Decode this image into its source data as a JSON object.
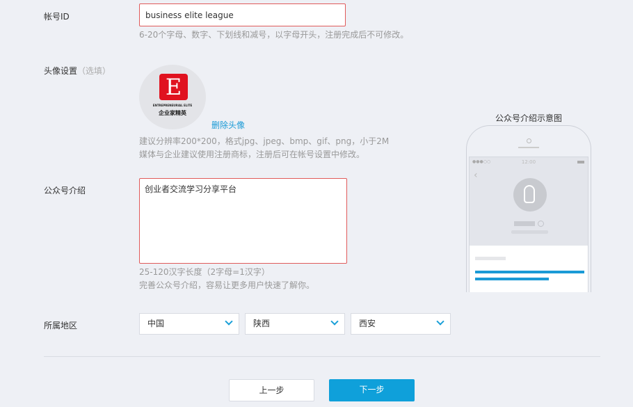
{
  "account_id": {
    "label": "帐号ID",
    "value": "business elite league",
    "hint": "6-20个字母、数字、下划线和减号，以字母开头，注册完成后不可修改。"
  },
  "avatar": {
    "label": "头像设置",
    "optional": "（选填）",
    "logo_text_en": "ENTREPRENEURIAL ELITE",
    "logo_text_cn": "企业家精英",
    "delete_link": "删除头像",
    "hint1": "建议分辨率200*200，格式jpg、jpeg、bmp、gif、png，小于2M",
    "hint2": "媒体与企业建议使用注册商标，注册后可在帐号设置中修改。"
  },
  "intro": {
    "label": "公众号介绍",
    "value": "创业者交流学习分享平台",
    "hint1": "25-120汉字长度（2字母=1汉字）",
    "hint2": "完善公众号介绍，容易让更多用户快速了解你。"
  },
  "region": {
    "label": "所属地区",
    "country": "中国",
    "province": "陕西",
    "city": "西安"
  },
  "preview": {
    "title": "公众号介绍示意图",
    "time": "12:00"
  },
  "buttons": {
    "prev": "上一步",
    "next": "下一步"
  },
  "colors": {
    "accent": "#0fa0da",
    "error_border": "#e05a5a",
    "background": "#eef0f5"
  }
}
